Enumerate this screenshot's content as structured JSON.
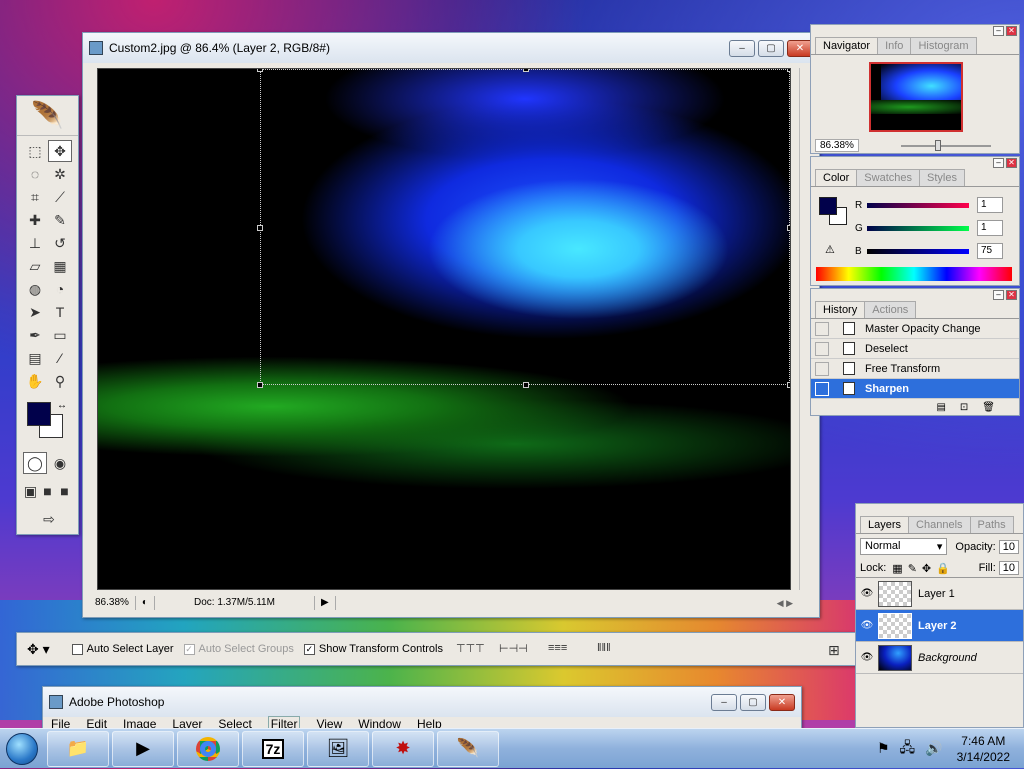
{
  "document": {
    "title": "Custom2.jpg @ 86.4% (Layer 2, RGB/8#)",
    "zoom": "86.38%",
    "doc_size": "Doc: 1.37M/5.11M"
  },
  "options_bar": {
    "auto_select_layer": "Auto Select Layer",
    "auto_select_groups": "Auto Select Groups",
    "show_transform_controls": "Show Transform Controls"
  },
  "navigator": {
    "tabs": [
      "Navigator",
      "Info",
      "Histogram"
    ],
    "zoom": "86.38%"
  },
  "color": {
    "tabs": [
      "Color",
      "Swatches",
      "Styles"
    ],
    "r_label": "R",
    "r_value": "1",
    "g_label": "G",
    "g_value": "1",
    "b_label": "B",
    "b_value": "75",
    "foreground": "#01014b"
  },
  "history": {
    "tabs": [
      "History",
      "Actions"
    ],
    "items": [
      "Master Opacity Change",
      "Deselect",
      "Free Transform",
      "Sharpen"
    ]
  },
  "layers": {
    "tabs": [
      "Layers",
      "Channels",
      "Paths"
    ],
    "blend_mode": "Normal",
    "opacity_label": "Opacity:",
    "opacity_value": "10",
    "lock_label": "Lock:",
    "fill_label": "Fill:",
    "fill_value": "10",
    "items": [
      "Layer 1",
      "Layer 2",
      "Background"
    ]
  },
  "app": {
    "title": "Adobe Photoshop",
    "menu": [
      "File",
      "Edit",
      "Image",
      "Layer",
      "Select",
      "Filter",
      "View",
      "Window",
      "Help"
    ]
  },
  "taskbar": {
    "time": "7:46 AM",
    "date": "3/14/2022"
  }
}
